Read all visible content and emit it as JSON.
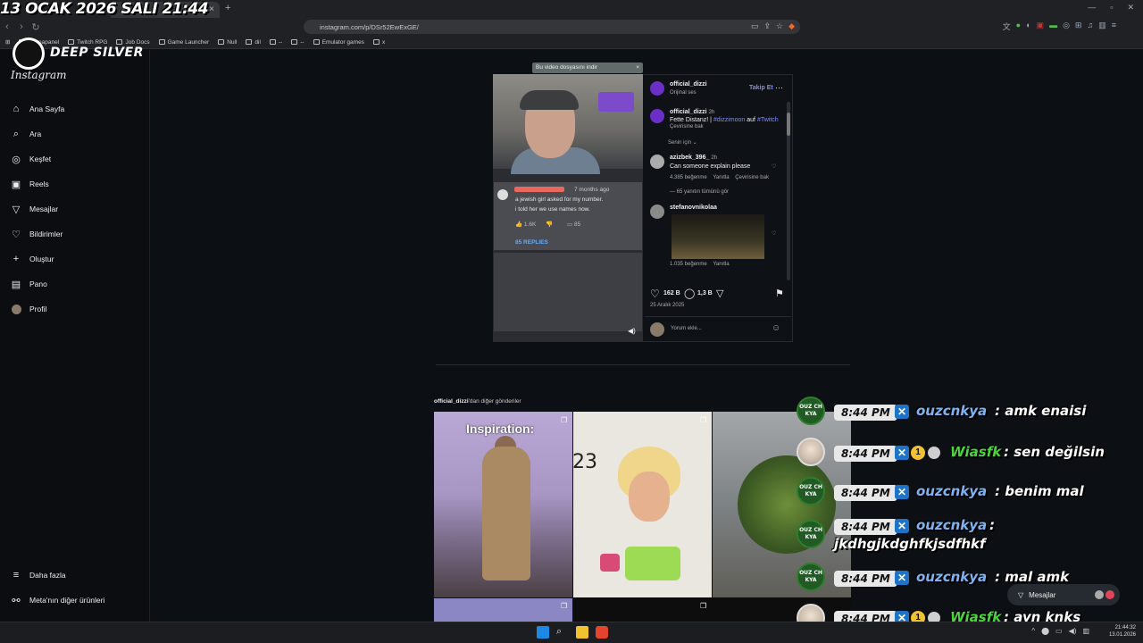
{
  "overlay": {
    "date_text": "13 OCAK 2026 SALI 21:44"
  },
  "browser": {
    "tab_title": "",
    "url": "instagram.com/p/DSr52EwExGE/",
    "bookmarks": [
      "Shanapanel",
      "Twitch RPG",
      "Job Docs",
      "Game Launcher",
      "Null",
      "dil",
      "--",
      "--",
      "Emulator games",
      "x"
    ]
  },
  "brand": {
    "deep_silver": "DEEP SILVER",
    "instagram": "Instagram"
  },
  "sidebar": {
    "items": [
      {
        "label": "Ana Sayfa",
        "icon": "home-icon"
      },
      {
        "label": "Ara",
        "icon": "search-icon"
      },
      {
        "label": "Keşfet",
        "icon": "compass-icon"
      },
      {
        "label": "Reels",
        "icon": "reels-icon"
      },
      {
        "label": "Mesajlar",
        "icon": "send-icon"
      },
      {
        "label": "Bildirimler",
        "icon": "heart-icon"
      },
      {
        "label": "Oluştur",
        "icon": "plus-icon"
      },
      {
        "label": "Pano",
        "icon": "dashboard-icon"
      },
      {
        "label": "Profil",
        "icon": "avatar-icon"
      }
    ],
    "more": "Daha fazla",
    "meta": "Meta'nın diğer ürünleri"
  },
  "video": {
    "download_pill": "Bu video dosyasını indir",
    "comment_time": "7 months ago",
    "comment_line1": "a jewish girl asked for my number.",
    "comment_line2": "i told her we use names now.",
    "likes": "1.6K",
    "dislikes": "85",
    "replies": "85 REPLIES"
  },
  "post": {
    "username": "official_dizzi",
    "audio": "Orijinal ses",
    "follow": "Takip Et",
    "caption_user": "official_dizzi",
    "caption_time": "2h",
    "caption_text": "Fette Distanz! | ",
    "caption_tag1": "#dizzimoon",
    "caption_mid": " auf ",
    "caption_tag2": "#Twitch",
    "caption_translate": "Çevirisine bak",
    "for_you": "Senin için",
    "comments": [
      {
        "user": "azizbek_396_",
        "time": "2h",
        "text": "Can someone explain please",
        "likes": "4.385 beğenme",
        "reply": "Yanıtla",
        "translate": "Çevirisine bak",
        "view_replies": "65 yanıtın tümünü gör"
      },
      {
        "user": "stefanovnikolaa",
        "likes": "1.035 beğenme",
        "reply": "Yanıtla"
      }
    ],
    "like_count": "162 B",
    "comment_count": "1,3 B",
    "date": "25 Aralık 2025",
    "comment_placeholder": "Yorum ekle..."
  },
  "more_posts": {
    "label_user": "official_dizzi",
    "label_rest": "'dan diğer gönderiler",
    "tiles": [
      {
        "caption": "Inspiration:"
      },
      {
        "number": "23"
      },
      {}
    ]
  },
  "chat": [
    {
      "time": "8:44 PM",
      "user": "ouzcnkya",
      "msg": " : amk enaisi",
      "avatar": "OUZ CH KYA",
      "color": "blue"
    },
    {
      "time": "8:44 PM",
      "user": "Wiasfk",
      "msg": " : sen değilsin",
      "avatar": "",
      "color": "green"
    },
    {
      "time": "8:44 PM",
      "user": "ouzcnkya",
      "msg": " : benim mal",
      "avatar": "OUZ CH KYA",
      "color": "blue"
    },
    {
      "time": "8:44 PM",
      "user": "ouzcnkya",
      "msg": " :",
      "msg2": "jkdhgjkdghfkjsdfhkf",
      "avatar": "OUZ CH KYA",
      "color": "blue"
    },
    {
      "time": "8:44 PM",
      "user": "ouzcnkya",
      "msg": " : mal amk",
      "avatar": "OUZ CH KYA",
      "color": "blue"
    },
    {
      "time": "8:44 PM",
      "user": "Wiasfk",
      "msg": " : ayn knks",
      "avatar": "",
      "color": "green"
    }
  ],
  "badges": {
    "sub_count": "1"
  },
  "messages_pill": {
    "label": "Mesajlar"
  },
  "taskbar": {
    "time": "21:44:32",
    "date": "13.01.2026"
  },
  "colors": {
    "accent_blue": "#0095f6",
    "twitch_purple": "#7b4bc9",
    "chat_blue": "#7fb2f0",
    "chat_green": "#4ad53c"
  }
}
